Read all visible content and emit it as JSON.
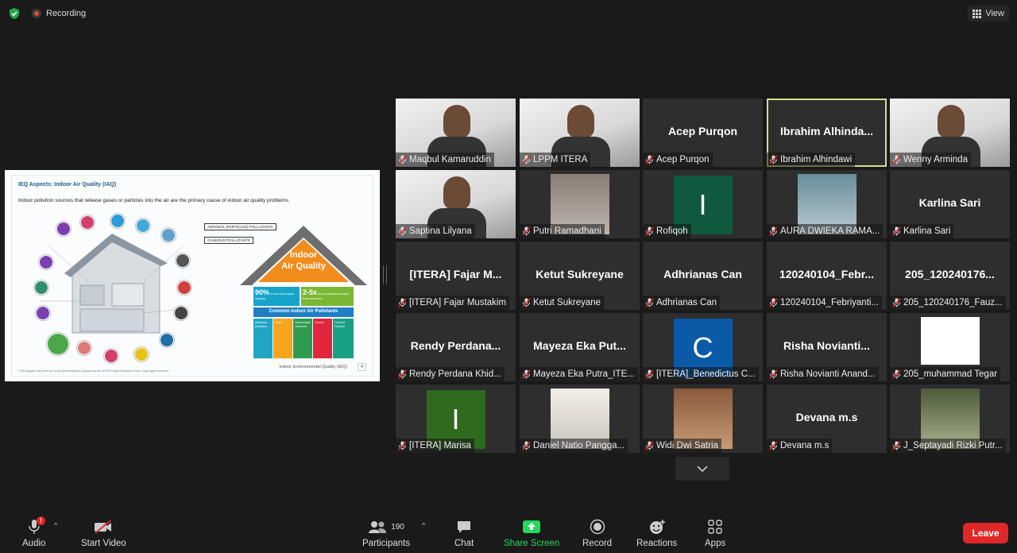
{
  "top_bar": {
    "recording_label": "Recording",
    "view_label": "View"
  },
  "shared_slide": {
    "title": "IEQ Aspects: Indoor Air Quality (IAQ)",
    "description": "Indoor pollution sources that release gases or particles into the air are the primary cause of indoor air quality problems.",
    "legend_aerosol": "AEROSOL (PARTICLES) POLLUTANTS",
    "legend_gaseous": "GASEOUS POLLUTANTS",
    "roof_line1": "Indoor",
    "roof_line2": "Air Quality",
    "stat1_big": "90%",
    "stat1_text": "of our lives spent indoors",
    "stat2_big": "2-5x",
    "stat2_text": "More pollution indoors than outdoors",
    "common_pollutants": "Common Indoor Air Pollutants",
    "pollutant_labels": [
      "Airborne particles",
      "Mold",
      "Household cleaners",
      "Ozone",
      "Carbon Dioxide"
    ],
    "footer_note": "*This diagram has been set up for demonstration purposes by the ACHR Project Research Team. Copy rights reserved.",
    "footer_right": "Indoor Environmental Quality (IEQ)",
    "page_number": "4",
    "diagram_labels": [
      "Smoking",
      "Candles & Incense Burners",
      "Fireplace",
      "HVAC",
      "Appliances",
      "Building Materials",
      "Molds & Bacteria",
      "Dryer",
      "Ambient sources",
      "Radon",
      "Combustion",
      "Cooking & Cleaning",
      "Chemicals",
      "Pets"
    ]
  },
  "participants_tiles": [
    {
      "label": "Maqbul Kamaruddin",
      "type": "video"
    },
    {
      "label": "LPPM ITERA",
      "type": "video"
    },
    {
      "label": "Acep Purqon",
      "center_name": "Acep Purqon",
      "type": "name"
    },
    {
      "label": "Ibrahim Alhindawi",
      "center_name": "Ibrahim  Alhinda...",
      "type": "name",
      "active": true
    },
    {
      "label": "Wenny Arminda",
      "type": "video"
    },
    {
      "label": "Saptina Lilyana",
      "type": "video"
    },
    {
      "label": "Putri Ramadhani",
      "type": "photo"
    },
    {
      "label": "Rofiqoh",
      "avatar_letter": "I",
      "avatar_color": "#0f5a3f",
      "type": "avatar"
    },
    {
      "label": "AURA DWIEKA RAMA...",
      "type": "photo"
    },
    {
      "label": "Karlina Sari",
      "center_name": "Karlina Sari",
      "type": "name"
    },
    {
      "label": "[ITERA] Fajar Mustakim",
      "center_name": "[ITERA]  Fajar  M...",
      "type": "name"
    },
    {
      "label": "Ketut Sukreyane",
      "center_name": "Ketut Sukreyane",
      "type": "name"
    },
    {
      "label": "Adhrianas Can",
      "center_name": "Adhrianas Can",
      "type": "name"
    },
    {
      "label": "120240104_Febriyanti...",
      "center_name": "120240104_Febr...",
      "type": "name"
    },
    {
      "label": "205_120240176_Fauz...",
      "center_name": "205_120240176...",
      "type": "name"
    },
    {
      "label": "Rendy Perdana Khid...",
      "center_name": "Rendy  Perdana...",
      "type": "name"
    },
    {
      "label": "Mayeza Eka Putra_ITE...",
      "center_name": "Mayeza  Eka  Put...",
      "type": "name"
    },
    {
      "label": "[ITERA]_Benedictus C...",
      "avatar_letter": "C",
      "avatar_color": "#0a5aa8",
      "type": "avatar"
    },
    {
      "label": "Risha Novianti Anand...",
      "center_name": "Risha  Novianti...",
      "type": "name"
    },
    {
      "label": "205_muhammad Tegar",
      "type": "blank"
    },
    {
      "label": "[ITERA] Marisa",
      "avatar_letter": "I",
      "avatar_color": "#2f6a1f",
      "type": "avatar"
    },
    {
      "label": "Daniel Natio Pangga...",
      "type": "photo"
    },
    {
      "label": "Widi Dwi Satria",
      "type": "photo"
    },
    {
      "label": "Devana m.s",
      "center_name": "Devana m.s",
      "type": "name"
    },
    {
      "label": "J_Septayadi Rizki Putr...",
      "type": "photo"
    }
  ],
  "toolbar": {
    "audio_label": "Audio",
    "audio_badge": "!",
    "video_label": "Start Video",
    "participants_count": "190",
    "participants_label": "Participants",
    "chat_label": "Chat",
    "share_label": "Share Screen",
    "record_label": "Record",
    "reactions_label": "Reactions",
    "apps_label": "Apps",
    "leave_label": "Leave"
  },
  "colors": {
    "background": "#1a1a1a",
    "tile_bg": "#2e2e2e",
    "active_speaker": "#d2e08a",
    "share_green": "#23d959",
    "leave_red": "#e02828"
  }
}
